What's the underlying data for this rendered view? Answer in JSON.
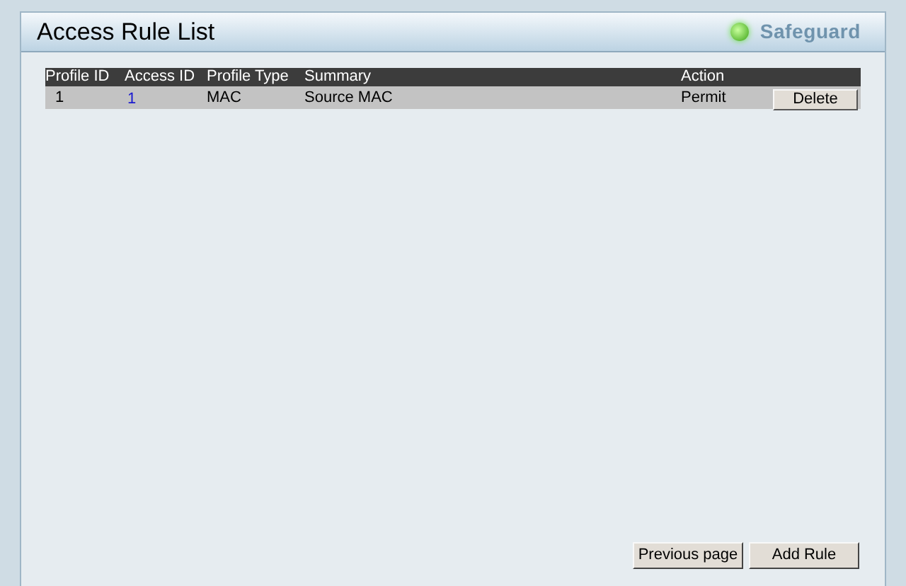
{
  "panel": {
    "title": "Access Rule List",
    "safeguard": {
      "label": "Safeguard",
      "on": true
    }
  },
  "table": {
    "columns": [
      "Profile ID",
      "Access ID",
      "Profile Type",
      "Summary",
      "Action"
    ],
    "rows": [
      {
        "profile_id": "1",
        "access_id": "1",
        "profile_type": "MAC",
        "summary": "Source MAC",
        "action": "Permit",
        "button": "Delete"
      }
    ]
  },
  "buttons": [
    "Previous page",
    "Add Rule"
  ]
}
